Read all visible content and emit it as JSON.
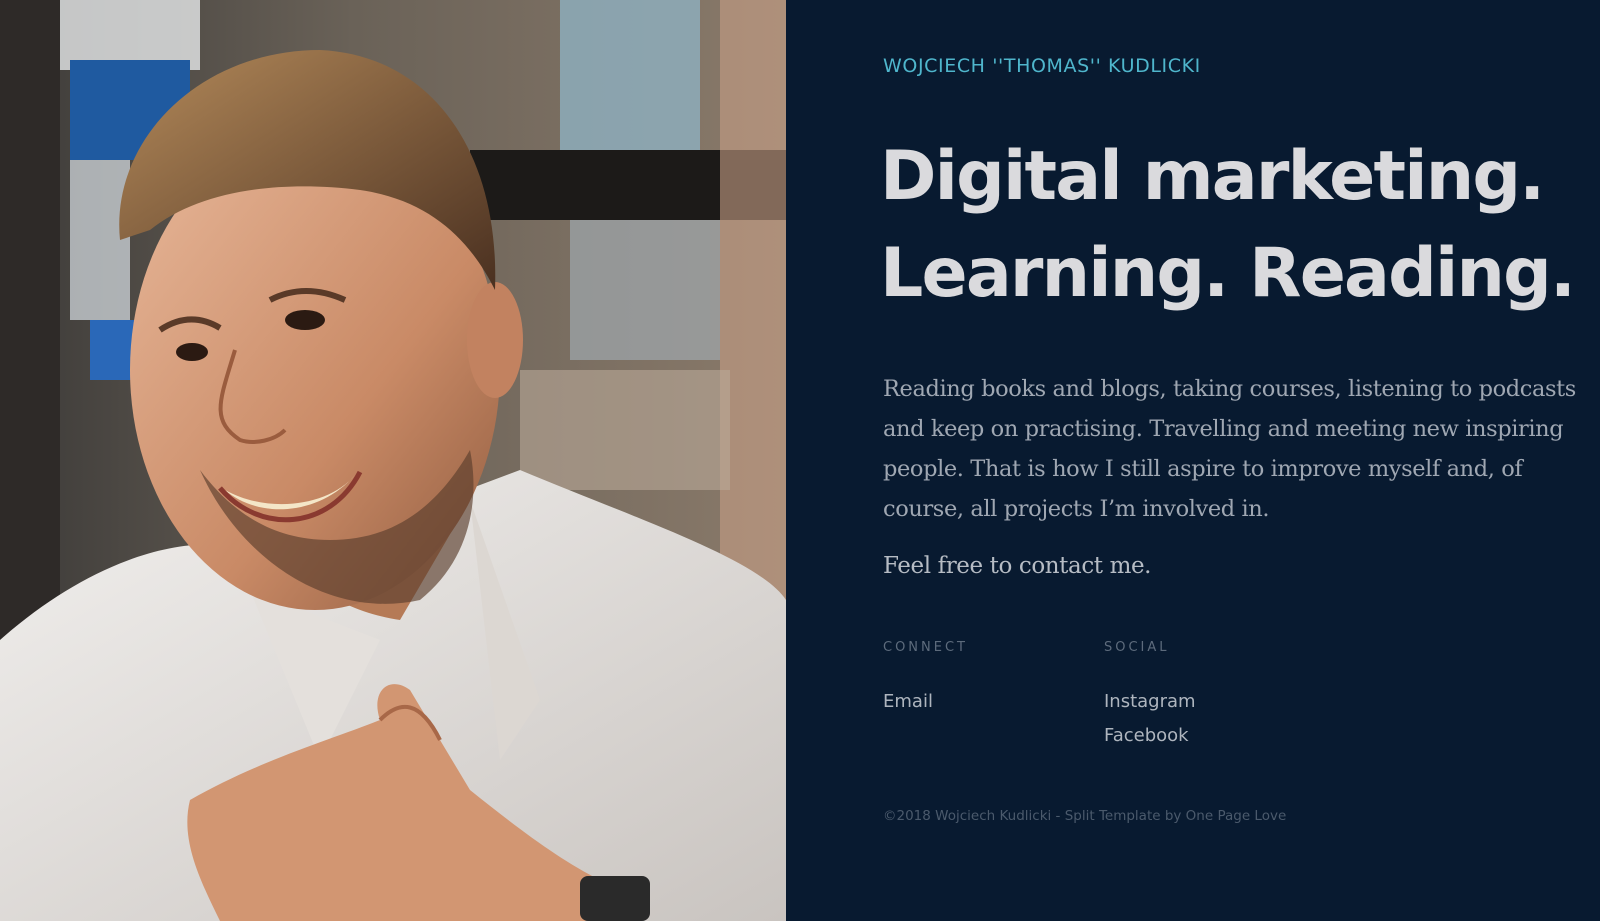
{
  "photo": {
    "alt": "Portrait photo"
  },
  "brand": {
    "name": "WOJCIECH ''THOMAS'' KUDLICKI",
    "color": "#4fb6cc"
  },
  "headline": {
    "line1": "Digital marketing.",
    "line2": "Learning. Reading."
  },
  "bio": {
    "text": "Reading books and blogs, taking courses, listening to podcasts and keep on practising. Travelling and meeting new inspiring people. That is how I still aspire to improve myself and, of course, all projects I’m involved in."
  },
  "cta": {
    "text": "Feel free to contact me."
  },
  "connect": {
    "title": "CONNECT",
    "links": [
      {
        "label": "Email"
      }
    ]
  },
  "social": {
    "title": "SOCIAL",
    "links": [
      {
        "label": "Instagram"
      },
      {
        "label": "Facebook"
      }
    ]
  },
  "footer": {
    "text": "©2018 Wojciech Kudlicki - Split Template by One Page Love"
  },
  "colors": {
    "background": "#081a30",
    "headline": "#dadadd",
    "body_text": "#9fa7b2",
    "muted": "#4b5a6c"
  }
}
